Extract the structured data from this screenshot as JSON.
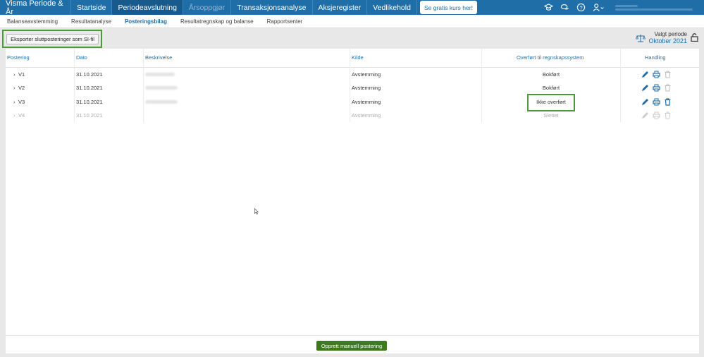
{
  "topbar": {
    "brand": "Visma Periode & År",
    "nav": [
      "Startside",
      "Periodeavslutning",
      "Årsoppgjør",
      "Transaksjonsanalyse",
      "Aksjeregister",
      "Vedlikehold"
    ],
    "course_button": "Se gratis kurs her!",
    "icons": [
      "graduation-cap-icon",
      "chat-icon",
      "help-icon",
      "user-icon"
    ]
  },
  "subnav": {
    "items": [
      "Balanseavstemming",
      "Resultatanalyse",
      "Posteringsbilag",
      "Resultatregnskap og balanse",
      "Rapportsenter"
    ],
    "active": "Posteringsbilag"
  },
  "toolbar": {
    "export_label": "Eksporter sluttposteringer som SI-fil",
    "period_label": "Valgt periode",
    "period_value": "Oktober 2021"
  },
  "table": {
    "columns": [
      "Postering",
      "Dato",
      "Beskrivelse",
      "Kilde",
      "Overført til regnskapssystem",
      "Handling"
    ],
    "rows": [
      {
        "id": "V1",
        "date": "31.10.2021",
        "source": "Avstemming",
        "status": "Bokført",
        "deleted": false
      },
      {
        "id": "V2",
        "date": "31.10.2021",
        "source": "Avstemming",
        "status": "Bokført",
        "deleted": false
      },
      {
        "id": "V3",
        "date": "31.10.2021",
        "source": "Avstemming",
        "status": "Ikke overført",
        "deleted": false
      },
      {
        "id": "V4",
        "date": "31.10.2021",
        "source": "Avstemming",
        "status": "Slettet",
        "deleted": true
      }
    ]
  },
  "footer": {
    "create_label": "Opprett manuell postering"
  },
  "colors": {
    "primary": "#1f6ea8",
    "highlight": "#4a9a38",
    "create_button": "#3d7a1e"
  }
}
